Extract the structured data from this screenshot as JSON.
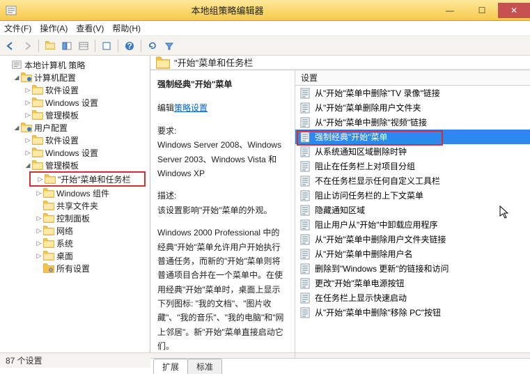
{
  "window": {
    "title": "本地组策略编辑器"
  },
  "menu": {
    "file": "文件(F)",
    "action": "操作(A)",
    "view": "查看(V)",
    "help": "帮助(H)"
  },
  "tree": {
    "root": "本地计算机 策略",
    "computer_cfg": "计算机配置",
    "software_settings": "软件设置",
    "windows_settings": "Windows 设置",
    "admin_templates": "管理模板",
    "user_cfg": "用户配置",
    "start_taskbar": "\"开始\"菜单和任务栏",
    "windows_components": "Windows 组件",
    "shared_folders": "共享文件夹",
    "control_panel": "控制面板",
    "network": "网络",
    "system": "系统",
    "desktop": "桌面",
    "all_settings": "所有设置"
  },
  "detail": {
    "header_title": "\"开始\"菜单和任务栏",
    "title": "强制经典\"开始\"菜单",
    "edit_link_prefix": "编辑",
    "edit_link": "策略设置",
    "req_label": "要求:",
    "req_text": "Windows Server 2008、Windows Server 2003、Windows Vista 和 Windows XP",
    "desc_label": "描述:",
    "desc_text": "该设置影响\"开始\"菜单的外观。",
    "desc_para2": "Windows 2000 Professional 中的经典\"开始\"菜单允许用户开始执行普通任务，而新的\"开始\"菜单则将普通项目合并在一个菜单中。在使用经典\"开始\"菜单时，桌面上显示下列图标: \"我的文档\"、\"图片收藏\"、\"我的音乐\"、\"我的电脑\"和\"网上邻居\"。新\"开始\"菜单直接启动它们。"
  },
  "list": {
    "header": "设置",
    "items": [
      "从\"开始\"菜单中删除\"TV 录像\"链接",
      "从\"开始\"菜单删除用户文件夹",
      "从\"开始\"菜单中删除\"视频\"链接",
      "强制经典\"开始\"菜单",
      "从系统通知区域删除时钟",
      "阻止在任务栏上对项目分组",
      "不在任务栏显示任何自定义工具栏",
      "阻止访问任务栏的上下文菜单",
      "隐藏通知区域",
      "阻止用户从\"开始\"中卸载应用程序",
      "从\"开始\"菜单中删除用户文件夹链接",
      "从\"开始\"菜单中删除用户名",
      "删除到\"Windows 更新\"的链接和访问",
      "更改\"开始\"菜单电源按钮",
      "在任务栏上显示快速启动",
      "从\"开始\"菜单中删除\"移除 PC\"按钮"
    ]
  },
  "tabs": {
    "extended": "扩展",
    "standard": "标准"
  },
  "status": "87 个设置"
}
